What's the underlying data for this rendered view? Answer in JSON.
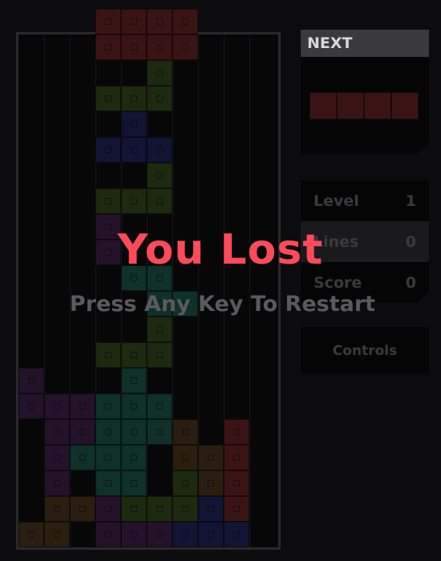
{
  "board": {
    "cols": 10,
    "rows": 20,
    "cells": [
      {
        "r": -1,
        "c": 3,
        "color": "#3a1415"
      },
      {
        "r": -1,
        "c": 4,
        "color": "#3a1415"
      },
      {
        "r": -1,
        "c": 5,
        "color": "#3a1415"
      },
      {
        "r": -1,
        "c": 6,
        "color": "#3a1415"
      },
      {
        "r": 0,
        "c": 3,
        "color": "#3a1415"
      },
      {
        "r": 0,
        "c": 4,
        "color": "#3a1415"
      },
      {
        "r": 0,
        "c": 5,
        "color": "#3a1415"
      },
      {
        "r": 0,
        "c": 6,
        "color": "#3a1415"
      },
      {
        "r": 1,
        "c": 5,
        "color": "#1d2a10"
      },
      {
        "r": 2,
        "c": 3,
        "color": "#1d2a10"
      },
      {
        "r": 2,
        "c": 4,
        "color": "#1d2a10"
      },
      {
        "r": 2,
        "c": 5,
        "color": "#1d2a10"
      },
      {
        "r": 3,
        "c": 4,
        "color": "#121433"
      },
      {
        "r": 4,
        "c": 3,
        "color": "#121433"
      },
      {
        "r": 4,
        "c": 4,
        "color": "#121433"
      },
      {
        "r": 4,
        "c": 5,
        "color": "#121433"
      },
      {
        "r": 5,
        "c": 5,
        "color": "#1d2a10"
      },
      {
        "r": 6,
        "c": 3,
        "color": "#1d2a10"
      },
      {
        "r": 6,
        "c": 4,
        "color": "#1d2a10"
      },
      {
        "r": 6,
        "c": 5,
        "color": "#1d2a10"
      },
      {
        "r": 7,
        "c": 3,
        "color": "#24122a"
      },
      {
        "r": 8,
        "c": 3,
        "color": "#24122a"
      },
      {
        "r": 9,
        "c": 4,
        "color": "#10302a"
      },
      {
        "r": 9,
        "c": 5,
        "color": "#10302a"
      },
      {
        "r": 10,
        "c": 5,
        "color": "#10302a"
      },
      {
        "r": 10,
        "c": 6,
        "color": "#10302a"
      },
      {
        "r": 11,
        "c": 5,
        "color": "#1d2a10"
      },
      {
        "r": 12,
        "c": 3,
        "color": "#1d2a10"
      },
      {
        "r": 12,
        "c": 4,
        "color": "#1d2a10"
      },
      {
        "r": 12,
        "c": 5,
        "color": "#1d2a10"
      },
      {
        "r": 13,
        "c": 0,
        "color": "#24122a"
      },
      {
        "r": 13,
        "c": 4,
        "color": "#10302a"
      },
      {
        "r": 14,
        "c": 0,
        "color": "#24122a"
      },
      {
        "r": 14,
        "c": 1,
        "color": "#24122a"
      },
      {
        "r": 14,
        "c": 2,
        "color": "#24122a"
      },
      {
        "r": 14,
        "c": 3,
        "color": "#10302a"
      },
      {
        "r": 14,
        "c": 4,
        "color": "#10302a"
      },
      {
        "r": 14,
        "c": 5,
        "color": "#10302a"
      },
      {
        "r": 15,
        "c": 1,
        "color": "#24122a"
      },
      {
        "r": 15,
        "c": 2,
        "color": "#24122a"
      },
      {
        "r": 15,
        "c": 3,
        "color": "#10302a"
      },
      {
        "r": 15,
        "c": 4,
        "color": "#10302a"
      },
      {
        "r": 15,
        "c": 5,
        "color": "#10302a"
      },
      {
        "r": 15,
        "c": 6,
        "color": "#2a1e10"
      },
      {
        "r": 15,
        "c": 8,
        "color": "#3a1415"
      },
      {
        "r": 16,
        "c": 1,
        "color": "#24122a"
      },
      {
        "r": 16,
        "c": 2,
        "color": "#10302a"
      },
      {
        "r": 16,
        "c": 3,
        "color": "#10302a"
      },
      {
        "r": 16,
        "c": 4,
        "color": "#10302a"
      },
      {
        "r": 16,
        "c": 6,
        "color": "#2a1e10"
      },
      {
        "r": 16,
        "c": 7,
        "color": "#2a1e10"
      },
      {
        "r": 16,
        "c": 8,
        "color": "#3a1415"
      },
      {
        "r": 17,
        "c": 1,
        "color": "#24122a"
      },
      {
        "r": 17,
        "c": 3,
        "color": "#10302a"
      },
      {
        "r": 17,
        "c": 4,
        "color": "#10302a"
      },
      {
        "r": 17,
        "c": 6,
        "color": "#1d2a10"
      },
      {
        "r": 17,
        "c": 7,
        "color": "#2a1e10"
      },
      {
        "r": 17,
        "c": 8,
        "color": "#3a1415"
      },
      {
        "r": 18,
        "c": 1,
        "color": "#2a1e10"
      },
      {
        "r": 18,
        "c": 2,
        "color": "#2a1e10"
      },
      {
        "r": 18,
        "c": 3,
        "color": "#24122a"
      },
      {
        "r": 18,
        "c": 4,
        "color": "#1d2a10"
      },
      {
        "r": 18,
        "c": 5,
        "color": "#1d2a10"
      },
      {
        "r": 18,
        "c": 6,
        "color": "#1d2a10"
      },
      {
        "r": 18,
        "c": 7,
        "color": "#121433"
      },
      {
        "r": 18,
        "c": 8,
        "color": "#3a1415"
      },
      {
        "r": 19,
        "c": 0,
        "color": "#2a1e10"
      },
      {
        "r": 19,
        "c": 1,
        "color": "#2a1e10"
      },
      {
        "r": 19,
        "c": 3,
        "color": "#24122a"
      },
      {
        "r": 19,
        "c": 4,
        "color": "#24122a"
      },
      {
        "r": 19,
        "c": 5,
        "color": "#24122a"
      },
      {
        "r": 19,
        "c": 6,
        "color": "#121433"
      },
      {
        "r": 19,
        "c": 7,
        "color": "#121433"
      },
      {
        "r": 19,
        "c": 8,
        "color": "#121433"
      }
    ]
  },
  "next": {
    "label": "NEXT",
    "piece": "I",
    "color": "#3a1415"
  },
  "stats": {
    "level_label": "Level",
    "level": "1",
    "lines_label": "Lines",
    "lines": "0",
    "score_label": "Score",
    "score": "0"
  },
  "controls_label": "Controls",
  "game_over": {
    "title": "You Lost",
    "subtitle": "Press Any Key To Restart"
  }
}
